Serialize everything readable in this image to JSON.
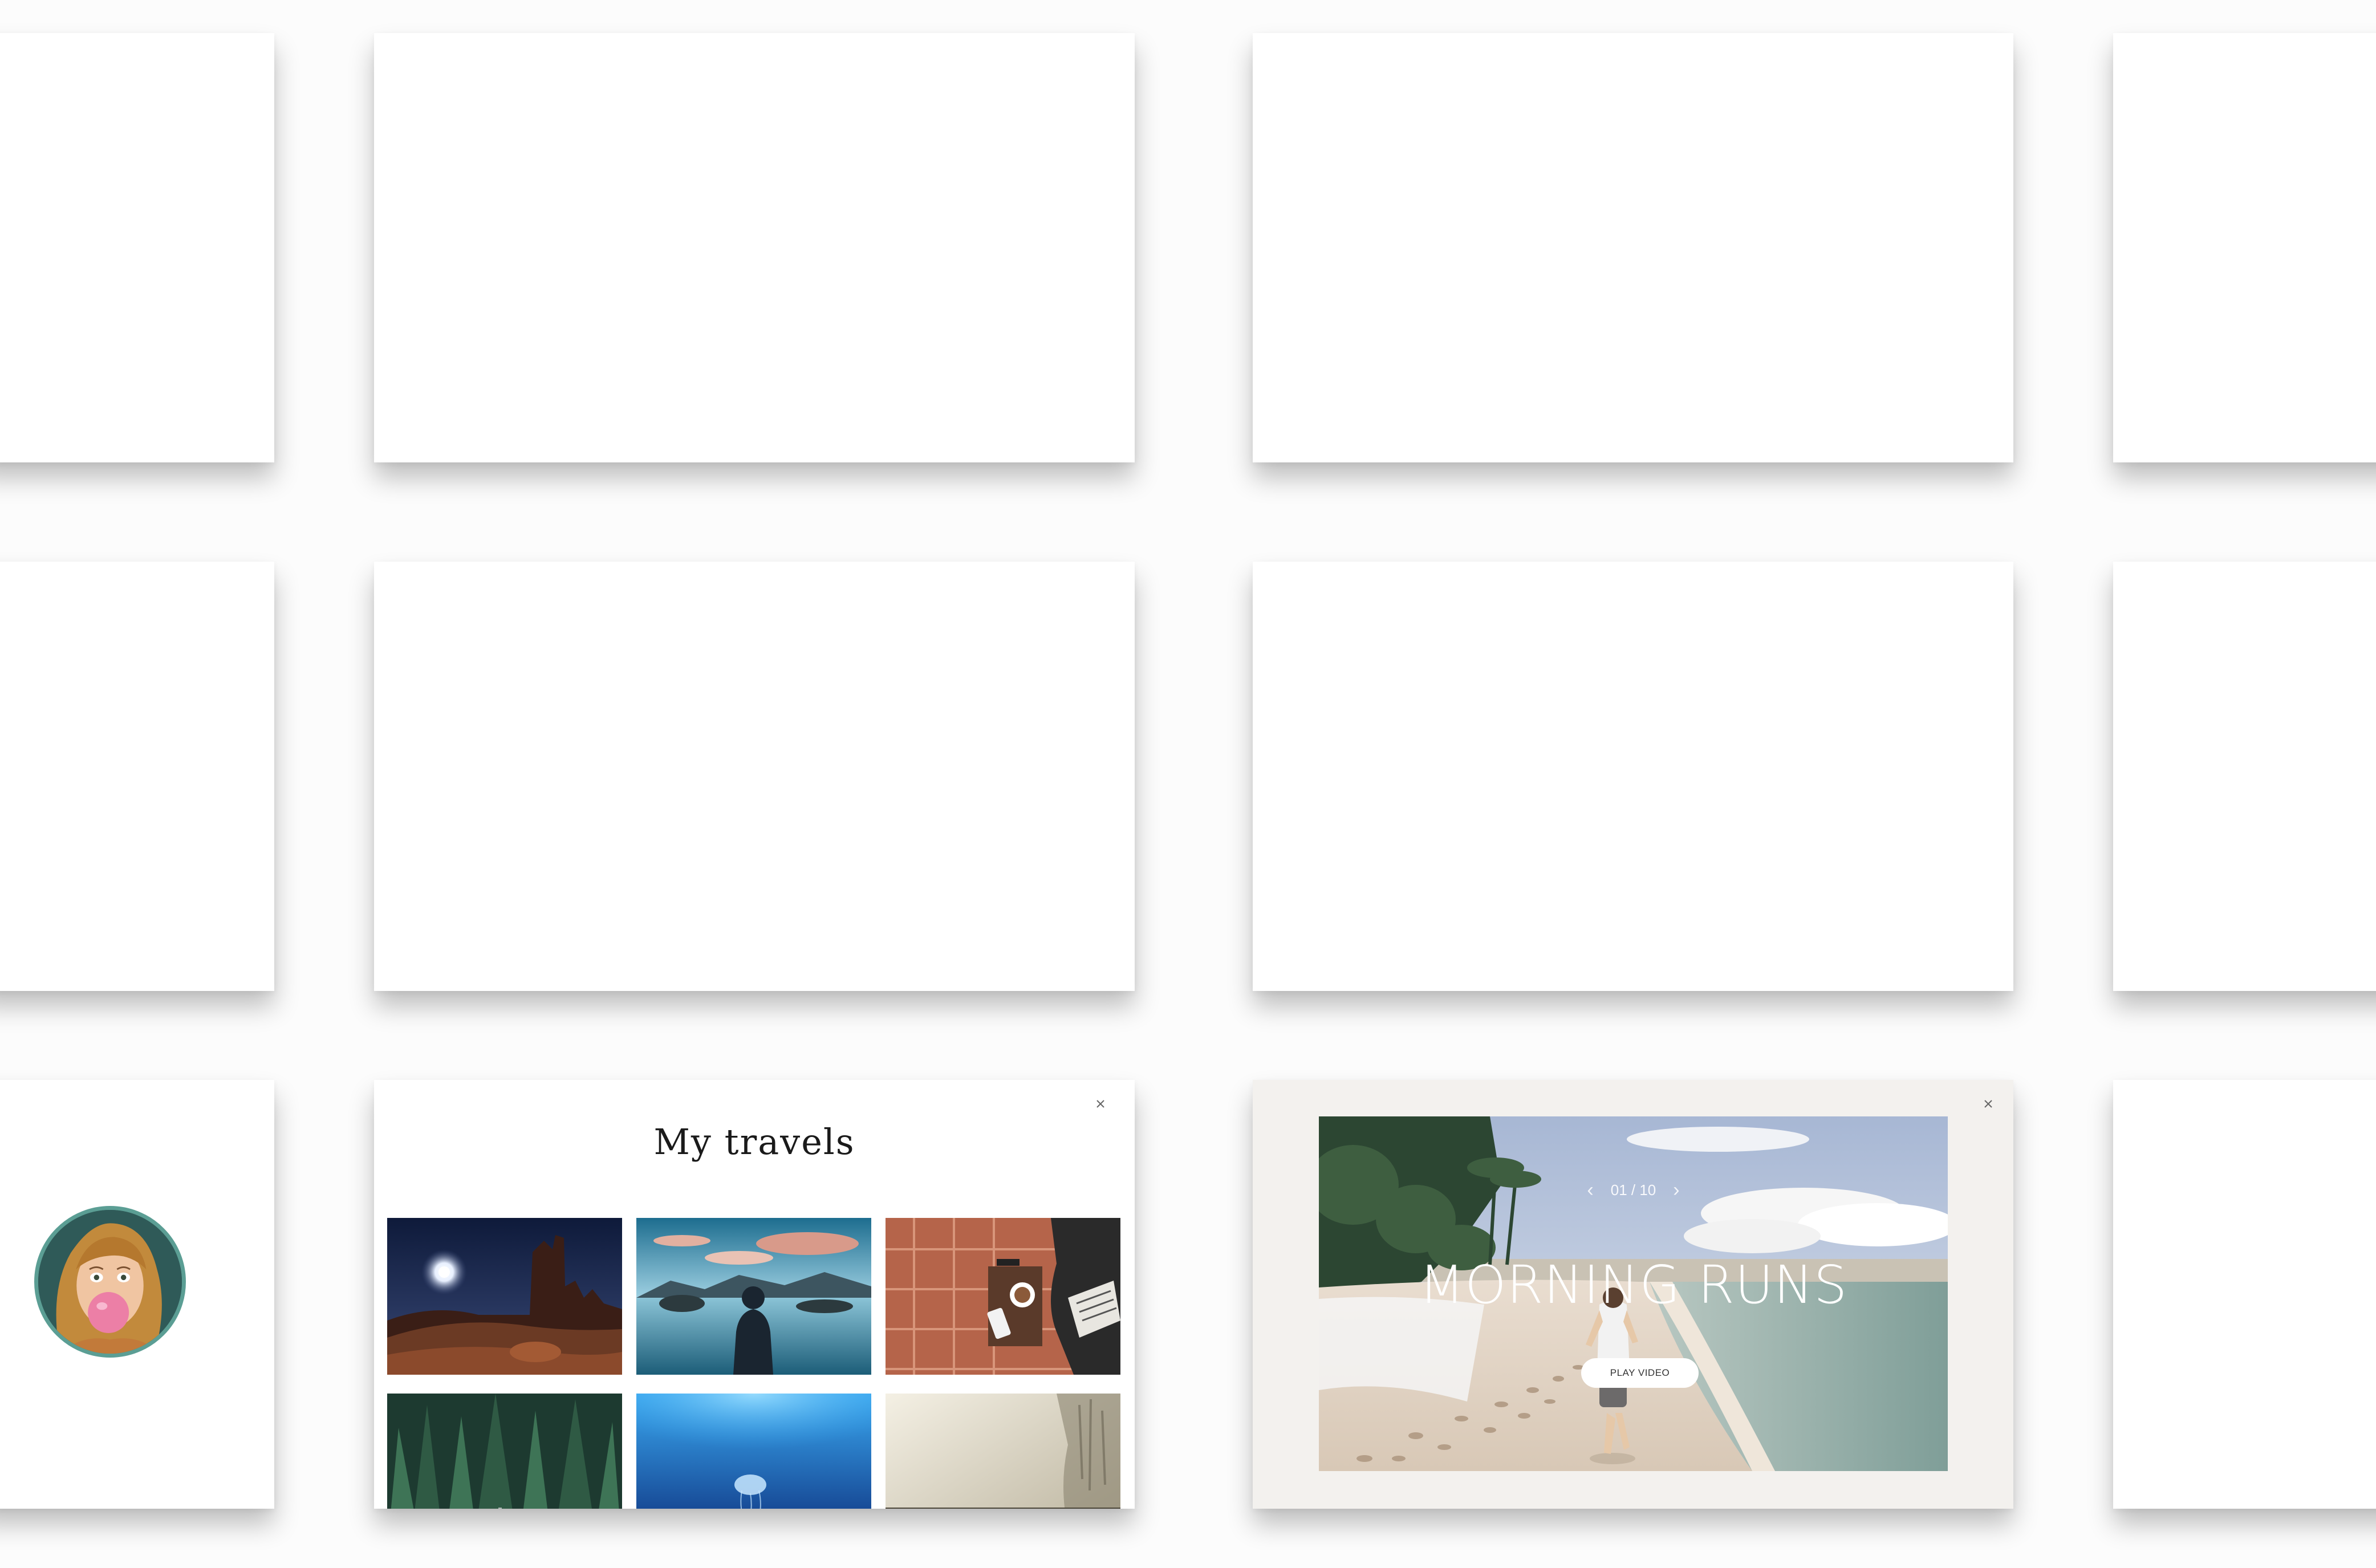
{
  "travels_card": {
    "title": "My travels",
    "photos": [
      {
        "subject": "desert rock formations under night sky with moon"
      },
      {
        "subject": "man standing by mountain lake with reflection"
      },
      {
        "subject": "coffee cup and phone on terracotta tile floor"
      },
      {
        "subject": "dark pine forest"
      },
      {
        "subject": "jellyfish in deep blue ocean"
      },
      {
        "subject": "misty foggy landscape"
      }
    ]
  },
  "video_card": {
    "counter": "01 / 10",
    "title": "MORNING RUNS",
    "play_label": "PLAY VIDEO"
  },
  "avatar": {
    "subject": "woman blowing bubble gum"
  },
  "icons": {
    "close": "close-icon",
    "prev": "chevron-left-icon",
    "next": "chevron-right-icon"
  }
}
